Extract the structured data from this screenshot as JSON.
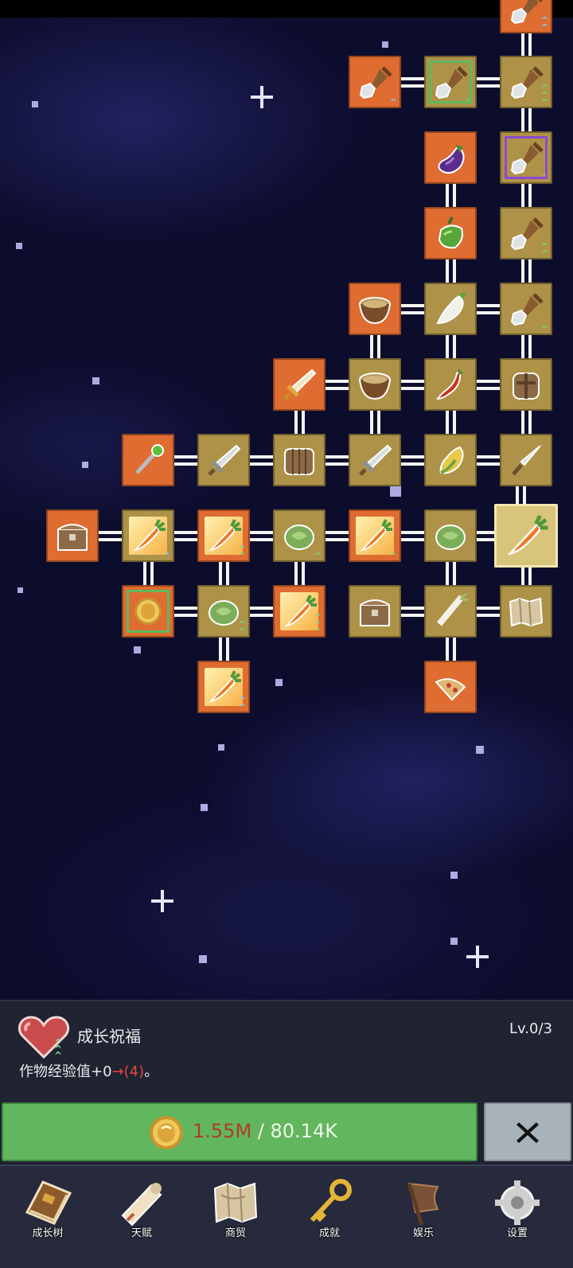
{
  "skill_tree": {
    "nodes": [
      {
        "id": "shovel-top",
        "icon": "shovel-icon",
        "style": "orange",
        "upgrade": "double-blue"
      },
      {
        "id": "shovel-a",
        "icon": "shovel-icon",
        "style": "orange",
        "upgrade": "single-blue"
      },
      {
        "id": "shovel-special-red",
        "icon": "shovel-icon",
        "style": "tan-green-frame",
        "upgrade": "single-green"
      },
      {
        "id": "shovel-b",
        "icon": "shovel-icon",
        "style": "tan",
        "upgrade": "triple-green"
      },
      {
        "id": "eggplant",
        "icon": "eggplant-icon",
        "style": "orange",
        "upgrade": ""
      },
      {
        "id": "shovel-special-purple",
        "icon": "shovel-icon",
        "style": "tan-purple-frame",
        "upgrade": "single-green"
      },
      {
        "id": "pepper",
        "icon": "bell-pepper-icon",
        "style": "orange",
        "upgrade": ""
      },
      {
        "id": "shovel-c",
        "icon": "shovel-icon",
        "style": "tan",
        "upgrade": "double-green"
      },
      {
        "id": "bowl-a",
        "icon": "bowl-icon",
        "style": "orange",
        "upgrade": ""
      },
      {
        "id": "radish",
        "icon": "radish-icon",
        "style": "tan",
        "upgrade": ""
      },
      {
        "id": "shovel-d",
        "icon": "shovel-icon",
        "style": "tan",
        "upgrade": "single-green"
      },
      {
        "id": "golden-sword",
        "icon": "golden-sword-icon",
        "style": "orange",
        "upgrade": ""
      },
      {
        "id": "bowl-b",
        "icon": "bowl-icon",
        "style": "tan",
        "upgrade": ""
      },
      {
        "id": "chili",
        "icon": "chili-icon",
        "style": "tan",
        "upgrade": ""
      },
      {
        "id": "backpack",
        "icon": "backpack-icon",
        "style": "tan",
        "upgrade": ""
      },
      {
        "id": "staff",
        "icon": "magic-staff-icon",
        "style": "orange",
        "upgrade": ""
      },
      {
        "id": "sword-a",
        "icon": "sword-icon",
        "style": "tan",
        "upgrade": ""
      },
      {
        "id": "crate",
        "icon": "crate-icon",
        "style": "tan",
        "upgrade": ""
      },
      {
        "id": "sword-b",
        "icon": "sword-icon",
        "style": "tan",
        "upgrade": ""
      },
      {
        "id": "corn",
        "icon": "corn-icon",
        "style": "tan",
        "upgrade": ""
      },
      {
        "id": "dagger",
        "icon": "dagger-icon",
        "style": "tan",
        "upgrade": ""
      },
      {
        "id": "chest-a",
        "icon": "treasure-chest-icon",
        "style": "orange",
        "upgrade": ""
      },
      {
        "id": "carrot-a",
        "icon": "carrot-icon",
        "style": "tan-glow",
        "upgrade": "single-blue"
      },
      {
        "id": "carrot-b",
        "icon": "carrot-icon",
        "style": "orange-glow",
        "upgrade": "double-green"
      },
      {
        "id": "cabbage-a",
        "icon": "cabbage-icon",
        "style": "tan",
        "upgrade": "single-green"
      },
      {
        "id": "carrot-c",
        "icon": "carrot-icon",
        "style": "orange-glow",
        "upgrade": "single-green"
      },
      {
        "id": "cabbage-b",
        "icon": "cabbage-icon",
        "style": "tan",
        "upgrade": ""
      },
      {
        "id": "carrot-selected",
        "icon": "carrot-icon",
        "style": "selected",
        "upgrade": ""
      },
      {
        "id": "coin",
        "icon": "gold-coin-icon",
        "style": "orange-green-frame",
        "upgrade": ""
      },
      {
        "id": "cabbage-c",
        "icon": "cabbage-icon",
        "style": "tan",
        "upgrade": "double-green"
      },
      {
        "id": "carrot-d",
        "icon": "carrot-icon",
        "style": "orange-glow",
        "upgrade": "triple-green"
      },
      {
        "id": "chest-b",
        "icon": "treasure-chest-icon",
        "style": "tan",
        "upgrade": ""
      },
      {
        "id": "leek",
        "icon": "leek-icon",
        "style": "tan",
        "upgrade": ""
      },
      {
        "id": "map",
        "icon": "map-icon",
        "style": "tan",
        "upgrade": ""
      },
      {
        "id": "carrot-e",
        "icon": "carrot-icon",
        "style": "orange-glow",
        "upgrade": "double-blue"
      },
      {
        "id": "pizza",
        "icon": "pizza-icon",
        "style": "orange",
        "upgrade": ""
      }
    ]
  },
  "detail": {
    "icon": "heart-icon",
    "title": "成长祝福",
    "level": "Lv.0/3",
    "desc_prefix": "作物经验值+0",
    "desc_arrow": "→",
    "desc_next": "(4)",
    "desc_suffix": "。"
  },
  "purchase": {
    "icon": "gold-coin-icon",
    "cost": "1.55M",
    "separator": " / ",
    "owned": "80.14K",
    "close_icon": "close-icon"
  },
  "nav": {
    "tabs": [
      {
        "label": "成长树",
        "icon": "book-icon"
      },
      {
        "label": "天赋",
        "icon": "scroll-icon"
      },
      {
        "label": "商贸",
        "icon": "map-icon"
      },
      {
        "label": "成就",
        "icon": "key-icon"
      },
      {
        "label": "娱乐",
        "icon": "flag-icon"
      },
      {
        "label": "设置",
        "icon": "gear-icon"
      }
    ]
  },
  "colors": {
    "node_orange": "#df6c30",
    "node_tan": "#ad9248",
    "buy_green": "#62b65d",
    "cost_red": "#b23a2d",
    "close_gray": "#a7b2b9"
  }
}
